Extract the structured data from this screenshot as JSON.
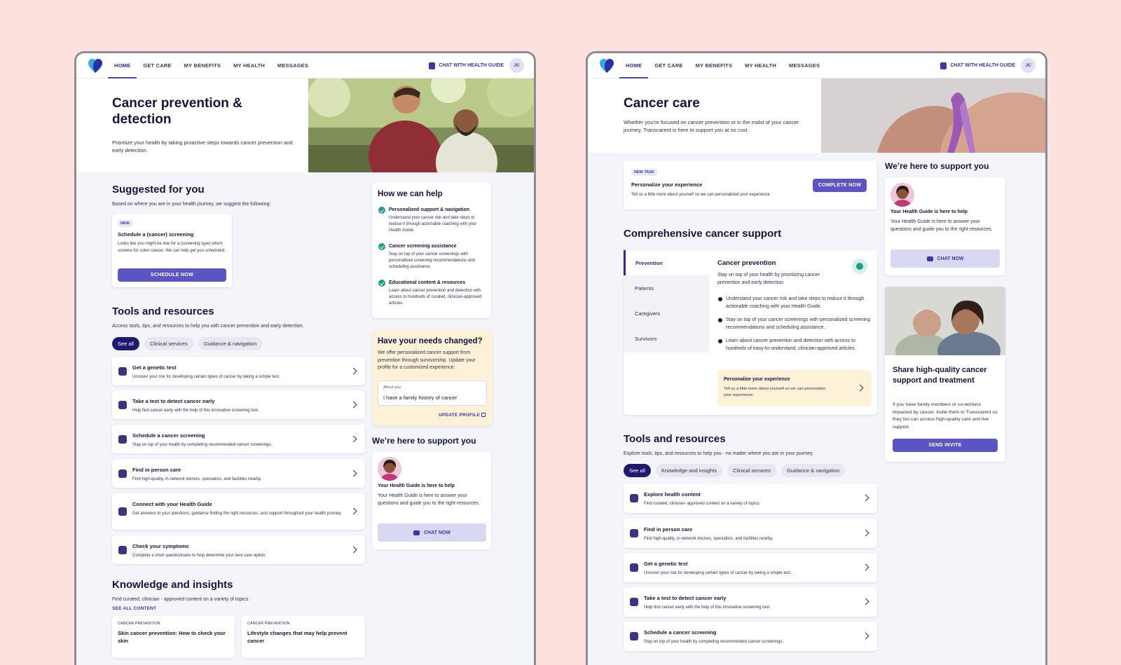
{
  "nav": {
    "links": [
      "HOME",
      "GET CARE",
      "MY BENEFITS",
      "MY HEALTH",
      "MESSAGES"
    ],
    "chat_guide": "CHAT WITH HEALTH GUIDE",
    "avatar": "JC"
  },
  "screenA": {
    "hero": {
      "title": "Cancer prevention & detection",
      "subtitle": "Prioritize your health by taking proactive steps towards cancer prevention and early detection."
    },
    "suggested": {
      "title": "Suggested for you",
      "subtitle": "Based on where you are in your health journey, we suggest the following:",
      "card": {
        "badge": "NEW",
        "title": "Schedule a (cancer) screening",
        "body": "Looks like you might be due for a (screening type) which screens for colon cancer. We can help get you scheduled.",
        "button": "SCHEDULE NOW"
      }
    },
    "how_help": {
      "title": "How we can help",
      "items": [
        {
          "title": "Personalized support & navigation",
          "body": "Understand your cancer risk and take steps to reduce it through actionable coaching with your Health Guide."
        },
        {
          "title": "Cancer screening assistance",
          "body": "Stay on top of your cancer screenings with personalized screening recommendations and scheduling assistance."
        },
        {
          "title": "Educational content & resources",
          "body": "Learn about cancer prevention and detection with access to hundreds of curated, clinician-approved articles."
        }
      ]
    },
    "needs": {
      "title": "Have your needs changed?",
      "body": "We offer personalized cancer support from prevention through survivorship. Update your profile for a customized experience:",
      "field_label": "About you",
      "field_value": "I have a family history of cancer",
      "link": "UPDATE PROFILE"
    },
    "support": {
      "title": "We’re here to support you",
      "card_title": "Your Health Guide is here to help",
      "card_body": "Your Health Guide is here to answer your questions and guide you to the right resources.",
      "button": "CHAT NOW"
    },
    "tools": {
      "title": "Tools and resources",
      "subtitle": "Access tools, tips, and resources to help you with cancer prevention and early detection.",
      "chips": [
        "See all",
        "Clinical services",
        "Guidance & navigation"
      ],
      "items": [
        {
          "title": "Get a genetic test",
          "desc": "Uncover your risk for developing certain types of cancer by taking a simple test."
        },
        {
          "title": "Take a test to detect cancer early",
          "desc": "Help find cancer early with the help of this innovative screening tool."
        },
        {
          "title": "Schedule a cancer screening",
          "desc": "Stay on top of your health by completing recommended cancer screenings."
        },
        {
          "title": "Find in person care",
          "desc": "Find high-quality, in-network doctors, specialists, and facilities nearby."
        },
        {
          "title": "Connect with your Health Guide",
          "desc": "Get answers to your questions, guidance finding the right resources, and support throughout your health journey."
        },
        {
          "title": "Check your symptoms",
          "desc": "Complete a short questionnaire to help determine your best care option."
        }
      ]
    },
    "knowledge": {
      "title": "Knowledge and insights",
      "subtitle": "Find curated, clinician - approved content on a variety of topics.",
      "link": "SEE ALL CONTENT",
      "cards": [
        {
          "tag": "CANCER PREVENTION",
          "title": "Skin cancer prevention: How to check your skin"
        },
        {
          "tag": "CANCER PREVENTION",
          "title": "Lifestyle changes that may help prevent cancer"
        }
      ]
    }
  },
  "screenB": {
    "hero": {
      "title": "Cancer care",
      "subtitle": "Whether you’re focused on cancer prevention or in the midst of your cancer journey, Transcarent is here to support you at no cost."
    },
    "task": {
      "badge": "NEW TASK",
      "title": "Personalize your experience",
      "body": "Tell us a little more about yourself so we can  personalized your experience",
      "button": "COMPLETE NOW"
    },
    "comprehensive": {
      "title": "Comprehensive cancer support",
      "tabs": [
        "Prevention",
        "Patients",
        "Caregivers",
        "Survivors"
      ],
      "panel_title": "Cancer prevention",
      "panel_intro": "Stay on top of your health by prioritizing cancer prevention and early detection:",
      "bullets": [
        "Understand your cancer risk and take steps to reduce it through actionable coaching with your Health Guide.",
        "Stay on top of your cancer screenings with personalized screening recommendations and scheduling assistance.",
        "Learn about cancer prevention and detection with access to hundreds of easy-to-understand, clinician-approved articles."
      ],
      "personalize_title": "Personalize your experience",
      "personalize_body": "Tell us a little more about yourself so we can personalize your experience."
    },
    "support": {
      "title": "We’re here to support you",
      "card_title": "Your Health Guide is here to help",
      "card_body": "Your Health Guide is here to answer your questions and guide you to the right resources.",
      "button": "CHAT NOW"
    },
    "share": {
      "title": "Share high-quality cancer support and treatment",
      "body": " If you have family members or co-workers impacted by cancer, invite them to Transcarent so they too can access high-quality care and live support.",
      "button": "SEND INVITE"
    },
    "tools": {
      "title": "Tools and resources",
      "subtitle": "Explore tools, tips, and resources to help you - no matter where you are in your journey.",
      "chips": [
        "See all",
        "Knowledge and insights",
        "Clinical services",
        "Guidance & navigation"
      ],
      "items": [
        {
          "title": "Explore health content",
          "desc": "Find curated, clinician- approved content on a variety of topics."
        },
        {
          "title": "Find in person care",
          "desc": "Find high-quality, in-network doctors, specialists, and facilities nearby."
        },
        {
          "title": "Get a genetic test",
          "desc": "Uncover your risk for developing certain types of cancer by taking a simple test."
        },
        {
          "title": "Take a test to detect cancer early",
          "desc": "Help find cancer early with the help of this innovative screening tool."
        },
        {
          "title": "Schedule a cancer screening",
          "desc": "Stay on top of your health by completing recommended cancer screenings."
        }
      ]
    }
  },
  "colors": {
    "background": "#fde1df",
    "primary": "#5b55c3",
    "navy": "#1e1b6e",
    "teal_check": "#1f9a8c",
    "cream": "#fdf1d8"
  }
}
